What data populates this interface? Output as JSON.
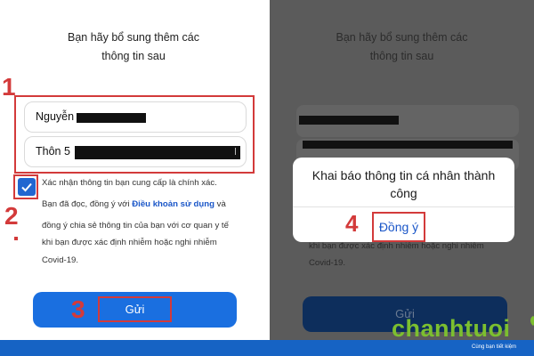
{
  "left": {
    "header_line1": "Bạn hãy bổ sung thêm các",
    "header_line2": "thông tin sau",
    "name_field_value": "Nguyễn",
    "address_field_value": "Thôn 5",
    "consent": {
      "line1": "Xác nhận thông tin bạn cung cấp là chính xác.",
      "line2_prefix": "Bạn đã đọc, đồng ý với ",
      "line2_link": "Điều khoản sử dụng",
      "line2_suffix": " và",
      "line3": "đồng ý chia sẻ thông tin của bạn với cơ quan y tế",
      "line4": "khi bạn được xác định nhiễm hoặc nghi nhiễm",
      "line5": "Covid-19."
    },
    "send_label": "Gửi",
    "checkbox_checked": true
  },
  "right": {
    "header_line1": "Bạn hãy bổ sung thêm các",
    "header_line2": "thông tin sau",
    "consent_line4": "khi bạn được xác định nhiễm hoặc nghi nhiễm",
    "consent_line5": "Covid-19.",
    "send_label": "Gửi",
    "dialog": {
      "message": "Khai báo thông tin cá nhân thành công",
      "ok_label": "Đồng ý"
    }
  },
  "step_numbers": [
    "1",
    "2",
    "3",
    "4"
  ],
  "logo": {
    "brand": "chanhtuoi",
    "tagline": "Cùng bạn tiết kiệm"
  },
  "colors": {
    "accent_red": "#d33a3a",
    "primary_blue": "#1a6fe0",
    "link_blue": "#1a56c8",
    "brand_green": "#7cbf2f",
    "footer_blue": "#1663c4"
  }
}
